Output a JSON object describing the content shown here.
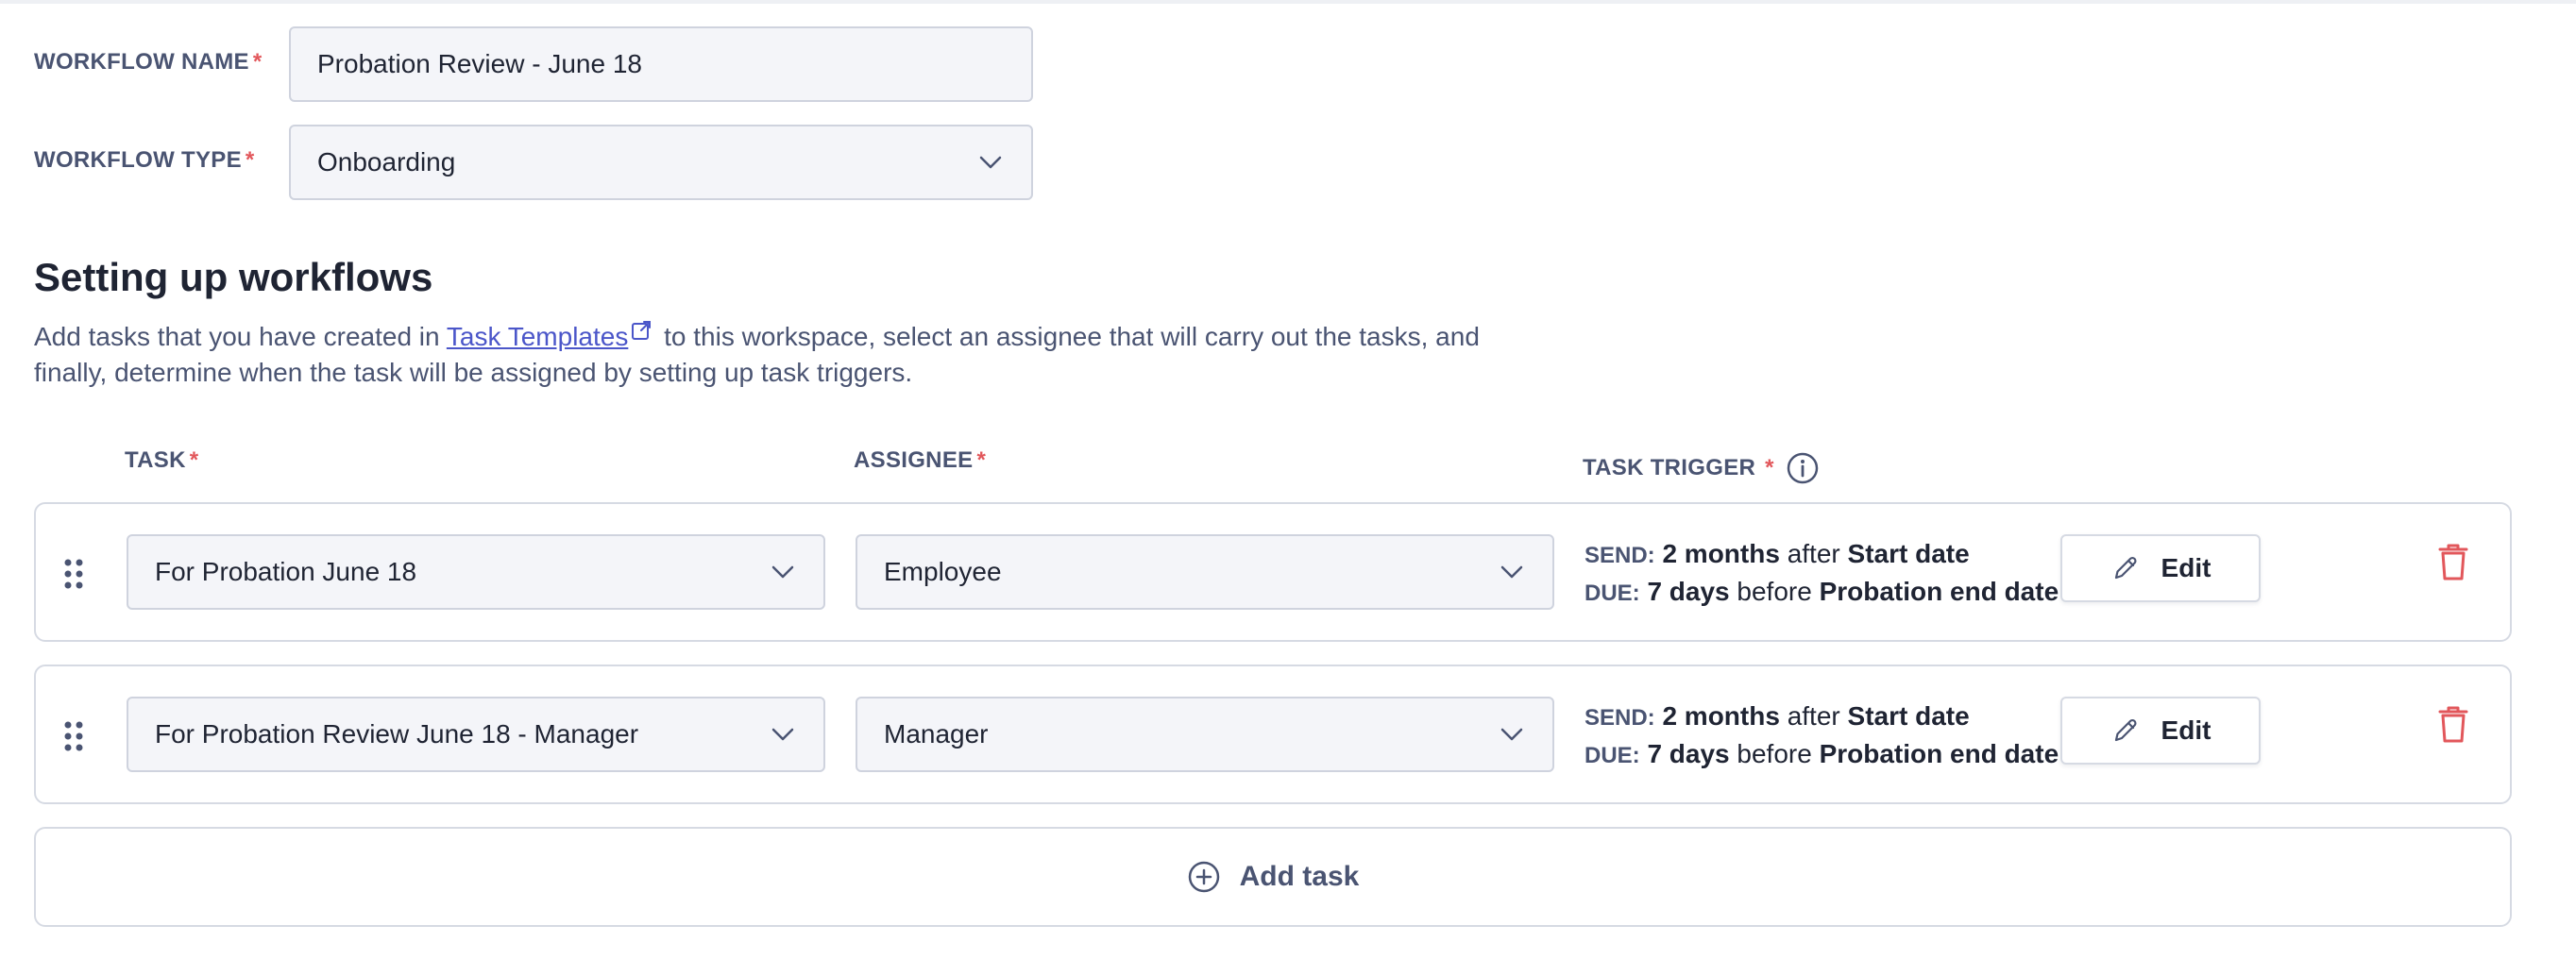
{
  "form": {
    "workflow_name_label": "WORKFLOW NAME",
    "workflow_name_value": "Probation Review - June 18",
    "workflow_type_label": "WORKFLOW TYPE",
    "workflow_type_value": "Onboarding",
    "required_mark": "*"
  },
  "section": {
    "title": "Setting up workflows",
    "desc_before": "Add tasks that you have created in ",
    "desc_link": "Task Templates",
    "desc_after": " to this workspace, select an assignee that will carry out the tasks, and finally, determine when the task will be assigned by setting up task triggers."
  },
  "columns": {
    "task": "TASK",
    "assignee": "ASSIGNEE",
    "trigger": "TASK TRIGGER"
  },
  "rows": [
    {
      "task": "For Probation June 18",
      "assignee": "Employee",
      "send_key": "SEND:",
      "send_amount": "2 months",
      "send_rel": " after ",
      "send_ref": "Start date",
      "due_key": "DUE:",
      "due_amount": "7 days",
      "due_rel": " before ",
      "due_ref": "Probation end date",
      "edit_label": "Edit"
    },
    {
      "task": "For Probation Review June 18 - Manager",
      "assignee": "Manager",
      "send_key": "SEND:",
      "send_amount": "2 months",
      "send_rel": " after ",
      "send_ref": "Start date",
      "due_key": "DUE:",
      "due_amount": "7 days",
      "due_rel": " before ",
      "due_ref": "Probation end date",
      "edit_label": "Edit"
    }
  ],
  "add_task_label": "Add task",
  "icons": {
    "chevron": "chevron-down-icon",
    "external": "external-link-icon",
    "info": "info-icon",
    "drag": "drag-handle-icon",
    "pencil": "pencil-icon",
    "trash": "trash-icon",
    "plus": "plus-circle-icon"
  },
  "colors": {
    "required": "#e2575b",
    "link": "#4b56c9",
    "delete": "#e2575b",
    "muted_text": "#4a5472"
  }
}
